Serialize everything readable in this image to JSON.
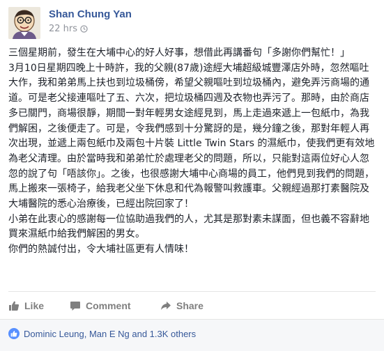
{
  "post": {
    "author": "Shan Chung Yan",
    "time": "22 hrs",
    "paragraphs": [
      "三個星期前，發生在大埔中心的好人好事，想借此再講番句「多謝你們幫忙！」",
      "3月10日星期四晚上十時許，我的父親(87歲)途經大埔超級城豐澤店外時，忽然嘔吐大作，我和弟弟馬上扶也到垃圾桶傍，希望父親嘔吐到垃圾桶內，避免弄污商場的通道。可是老父接連嘔吐了五、六次，把垃圾桶四週及衣物也弄污了。那時，由於商店多已關門，商場很靜，期間一對年輕男女途經見到，馬上走過來遞上一包紙巾，為我們解困，之後便走了。可是，令我們感到十分驚訝的是，幾分鐘之後，那對年輕人再次出現，並遞上兩包紙巾及兩包十片裝 Little Twin Stars 的濕紙巾，使我們更有效地為老父清理。由於當時我和弟弟忙於處理老父的問題，所以，只能對這兩位好心人忽忽的說了句「唔該你」。之後，也很感謝大埔中心商場的員工，他們見到我們的問題，馬上搬來一張椅子，給我老父坐下休息和代為報警叫救護車。父親經過那打素醫院及大埔醫院的悉心治療後，已經出院回家了！",
      "小弟在此衷心的感謝每一位協助過我們的人，尤其是那對素未謀面，但也義不容辭地買來濕紙巾給我們解困的男女。",
      "你們的熱誠付出，令大埔社區更有人情味！"
    ]
  },
  "actions": {
    "like": "Like",
    "comment": "Comment",
    "share": "Share"
  },
  "reactions": {
    "summary": "Dominic Leung, Man E Ng and 1.3K others"
  },
  "colors": {
    "link": "#365899",
    "muted": "#90949c",
    "like_badge": "#5890ff"
  }
}
